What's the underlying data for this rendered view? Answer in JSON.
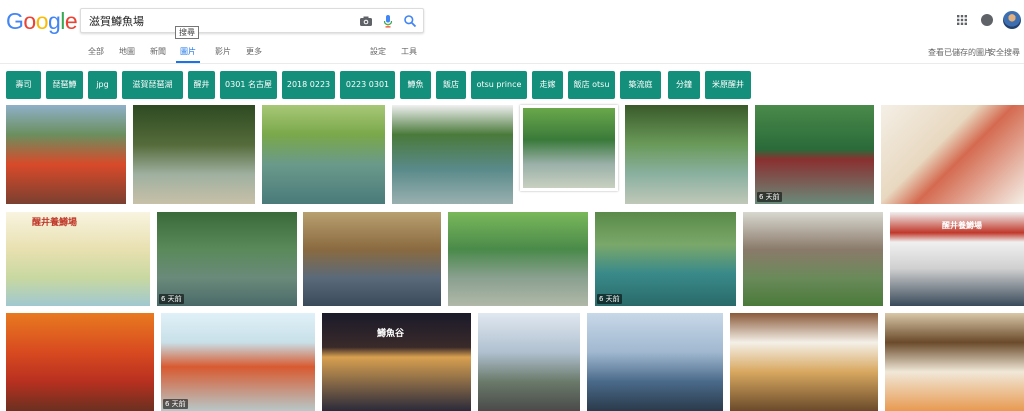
{
  "logo": {
    "letters": [
      {
        "ch": "G",
        "color": "#4285f4"
      },
      {
        "ch": "o",
        "color": "#ea4335"
      },
      {
        "ch": "o",
        "color": "#fbbc05"
      },
      {
        "ch": "g",
        "color": "#4285f4"
      },
      {
        "ch": "l",
        "color": "#34a853"
      },
      {
        "ch": "e",
        "color": "#ea4335"
      }
    ]
  },
  "search": {
    "query": "滋賀鱒魚場",
    "tooltip": "搜尋"
  },
  "tabs": [
    {
      "label": "全部",
      "active": false
    },
    {
      "label": "地圖",
      "active": false
    },
    {
      "label": "新聞",
      "active": false
    },
    {
      "label": "圖片",
      "active": true
    },
    {
      "label": "影片",
      "active": false
    },
    {
      "label": "更多",
      "active": false
    }
  ],
  "tools": {
    "settings": "設定",
    "tools": "工具"
  },
  "nav_right": {
    "saved_images": "查看已儲存的圖片",
    "safesearch": "安全搜尋"
  },
  "chips": [
    "壽司",
    "琵琶鱒",
    "jpg",
    "滋賀琵琶湖",
    "醒井",
    "0301 名古屋",
    "2018 0223",
    "0223 0301",
    "鱒魚",
    "飯店",
    "otsu prince",
    "走嫁",
    "飯店 otsu",
    "築流庭",
    "分鐘",
    "米原醒井"
  ],
  "thumb_badges": {
    "t8": "6 天前",
    "t10": "6 天前",
    "t13": "6 天前",
    "t18": "6 天前"
  },
  "thumb_texts": {
    "t9": "醒井養鱒場",
    "t15": "醒井養鱒場",
    "t21": "鱒魚谷"
  },
  "colors": {
    "accent": "#1a73e8",
    "chip": "#138f7b"
  }
}
